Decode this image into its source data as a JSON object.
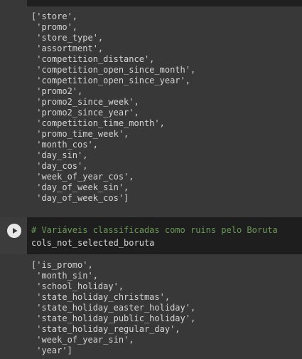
{
  "output_cell_1": {
    "text": "['store',\n 'promo',\n 'store_type',\n 'assortment',\n 'competition_distance',\n 'competition_open_since_month',\n 'competition_open_since_year',\n 'promo2',\n 'promo2_since_week',\n 'promo2_since_year',\n 'competition_time_month',\n 'promo_time_week',\n 'month_cos',\n 'day_sin',\n 'day_cos',\n 'week_of_year_cos',\n 'day_of_week_sin',\n 'day_of_week_cos']"
  },
  "code_cell": {
    "comment": "# Variáveis classificadas como ruins pelo Boruta",
    "code": "cols_not_selected_boruta",
    "run_icon": "play-icon"
  },
  "output_cell_2": {
    "text": "['is_promo',\n 'month_sin',\n 'school_holiday',\n 'state_holiday_christmas',\n 'state_holiday_easter_holiday',\n 'state_holiday_public_holiday',\n 'state_holiday_regular_day',\n 'week_of_year_sin',\n 'year']"
  },
  "colors": {
    "background": "#383838",
    "code_background": "#1e1e1e",
    "comment": "#6a9955",
    "text": "#d5d5d5"
  }
}
